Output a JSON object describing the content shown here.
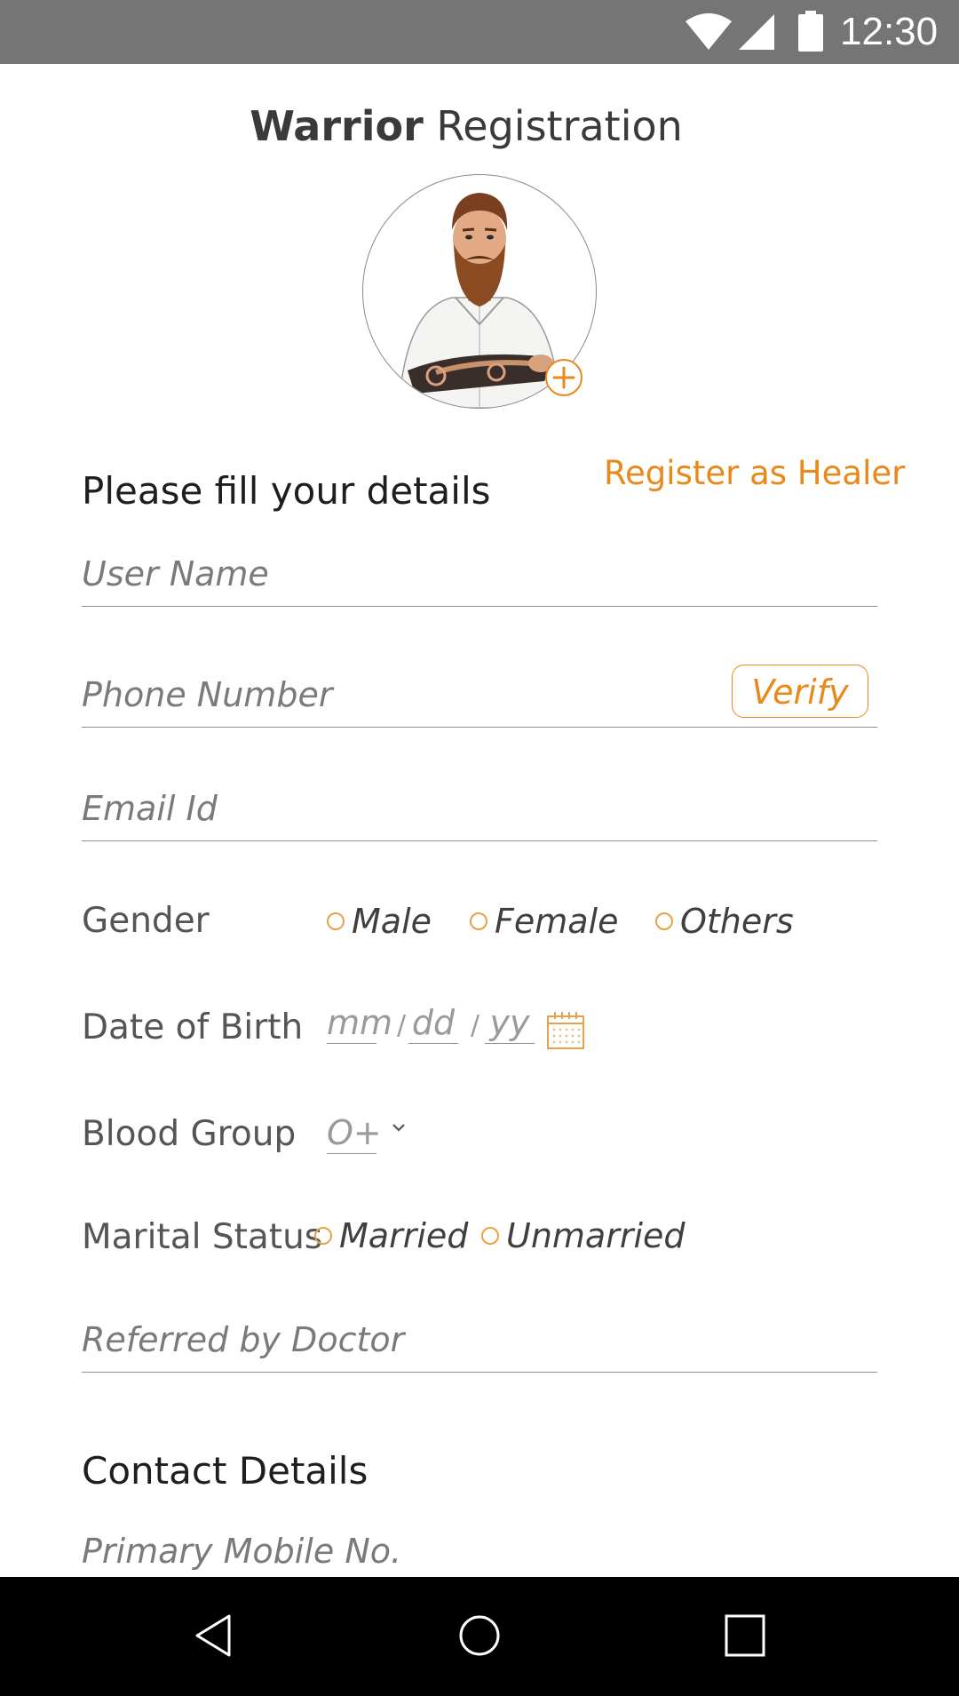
{
  "status_bar": {
    "time": "12:30",
    "icons": [
      "wifi-icon",
      "signal-icon",
      "battery-icon"
    ]
  },
  "header": {
    "title_strong": "Warrior",
    "title_rest": " Registration"
  },
  "avatar": {
    "add_icon": "plus-icon"
  },
  "form": {
    "heading": "Please fill your details",
    "healer_link": "Register as Healer",
    "username_placeholder": "User Name",
    "phone_placeholder": "Phone Number",
    "verify_label": "Verify",
    "email_placeholder": "Email Id",
    "gender": {
      "label": "Gender",
      "options": [
        "Male",
        "Female",
        "Others"
      ]
    },
    "dob": {
      "label": "Date of Birth",
      "mm": "mm",
      "dd": "dd",
      "yy": "yy",
      "sep": "/"
    },
    "blood_group": {
      "label": "Blood Group",
      "value": "O+"
    },
    "marital_status": {
      "label": "Marital Status",
      "options": [
        "Married",
        "Unmarried"
      ]
    },
    "referred_placeholder": "Referred by Doctor"
  },
  "contact": {
    "heading": "Contact Details",
    "primary_mobile_placeholder": "Primary Mobile No."
  },
  "colors": {
    "accent": "#e8891a",
    "status_bar": "#757575",
    "nav_bar": "#000000"
  },
  "nav_bar": {
    "buttons": [
      "back-icon",
      "home-icon",
      "recents-icon"
    ]
  }
}
